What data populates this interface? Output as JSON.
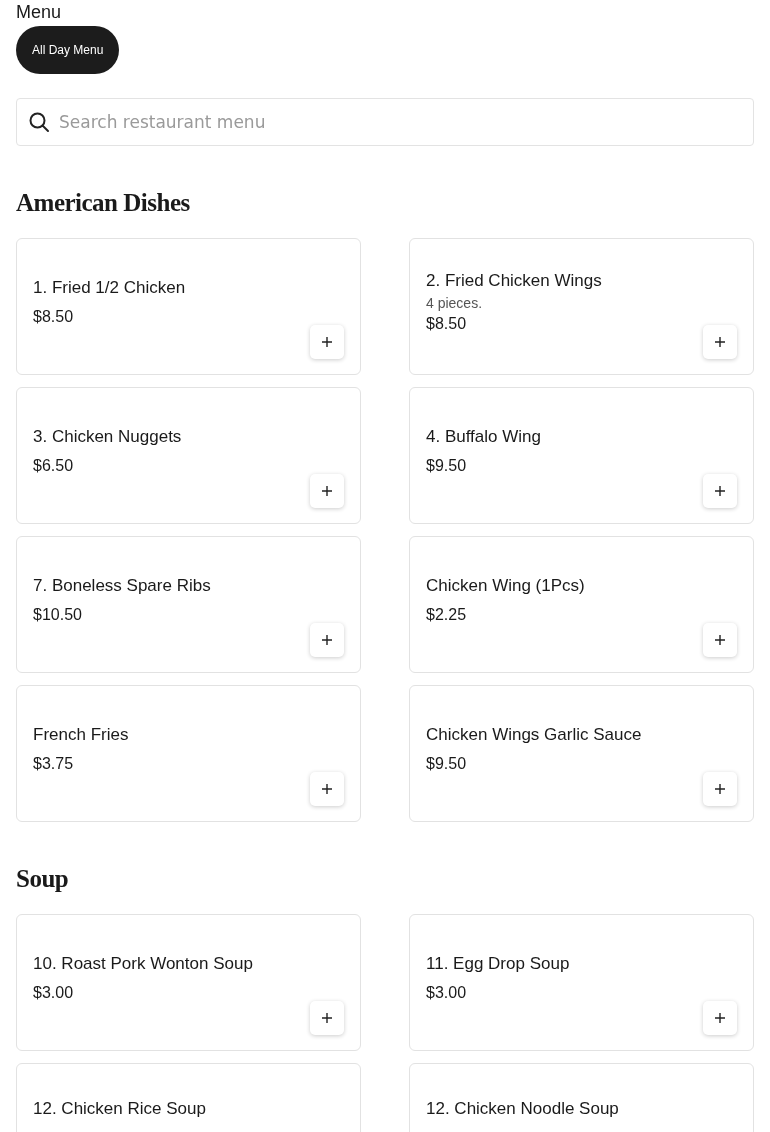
{
  "page_title": "Menu",
  "menu_tabs": [
    {
      "label": "All Day Menu",
      "selected": true
    }
  ],
  "search": {
    "placeholder": "Search restaurant menu"
  },
  "sections": [
    {
      "title": "American Dishes",
      "items": [
        {
          "name": "1. Fried 1/2 Chicken",
          "price": "$8.50"
        },
        {
          "name": "2. Fried Chicken Wings",
          "description": "4 pieces.",
          "price": "$8.50"
        },
        {
          "name": "3. Chicken Nuggets",
          "price": "$6.50"
        },
        {
          "name": "4. Buffalo Wing",
          "price": "$9.50"
        },
        {
          "name": "7. Boneless Spare Ribs",
          "price": "$10.50"
        },
        {
          "name": "Chicken Wing (1Pcs)",
          "price": "$2.25"
        },
        {
          "name": "French Fries",
          "price": "$3.75"
        },
        {
          "name": "Chicken Wings Garlic Sauce",
          "price": "$9.50"
        }
      ]
    },
    {
      "title": "Soup",
      "items": [
        {
          "name": "10. Roast Pork Wonton Soup",
          "price": "$3.00"
        },
        {
          "name": "11. Egg Drop Soup",
          "price": "$3.00"
        },
        {
          "name": "12. Chicken Rice Soup"
        },
        {
          "name": "12. Chicken Noodle Soup"
        }
      ]
    }
  ]
}
